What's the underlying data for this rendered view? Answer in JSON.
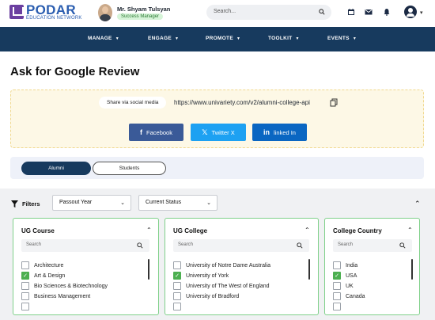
{
  "brand": {
    "name": "PODAR",
    "subtitle": "EDUCATION NETWORK",
    "color": "#2a5db0"
  },
  "user": {
    "name": "Mr. Shyam Tulsyan",
    "role": "Success Manager"
  },
  "header": {
    "search_placeholder": "Search...",
    "icons": [
      "calendar-icon",
      "mail-icon",
      "bell-icon",
      "account-icon"
    ]
  },
  "nav": {
    "items": [
      {
        "label": "MANAGE"
      },
      {
        "label": "ENGAGE"
      },
      {
        "label": "PROMOTE"
      },
      {
        "label": "TOOLKIT"
      },
      {
        "label": "EVENTS"
      }
    ]
  },
  "page": {
    "title": "Ask for Google Review"
  },
  "share": {
    "label": "Share via social media",
    "url": "https://www.univariety.com/v2/alumni-college-api",
    "buttons": [
      {
        "label": "Facebook",
        "color": "#3a5a98"
      },
      {
        "label": "Twitter X",
        "color": "#1da1f2"
      },
      {
        "label": "linked In",
        "color": "#0a66c2"
      }
    ]
  },
  "toggle": {
    "alumni": "Alumni",
    "students": "Students",
    "active": "Alumni"
  },
  "filters": {
    "label": "Filters",
    "passout_year": "Passout Year",
    "current_status": "Current Status"
  },
  "cards": [
    {
      "title": "UG Course",
      "search_placeholder": "Search",
      "options": [
        {
          "label": "Architecture",
          "checked": false
        },
        {
          "label": "Art & Design",
          "checked": true
        },
        {
          "label": "Bio Sciences & Biotechnology",
          "checked": false
        },
        {
          "label": "Business Management",
          "checked": false
        },
        {
          "label": "",
          "checked": false
        }
      ]
    },
    {
      "title": "UG College",
      "search_placeholder": "Search",
      "options": [
        {
          "label": "University of Notre Dame Australia",
          "checked": false
        },
        {
          "label": "University of York",
          "checked": true
        },
        {
          "label": "University of The West of England",
          "checked": false
        },
        {
          "label": "University of Bradford",
          "checked": false
        },
        {
          "label": "",
          "checked": false
        }
      ]
    },
    {
      "title": "College Country",
      "search_placeholder": "Search",
      "options": [
        {
          "label": "India",
          "checked": false
        },
        {
          "label": "USA",
          "checked": true
        },
        {
          "label": "UK",
          "checked": false
        },
        {
          "label": "Canada",
          "checked": false
        },
        {
          "label": "",
          "checked": false
        }
      ]
    }
  ],
  "colors": {
    "nav_bg": "#173a5e",
    "accent_green": "#4caf50",
    "share_bg": "#fdf8e6"
  }
}
